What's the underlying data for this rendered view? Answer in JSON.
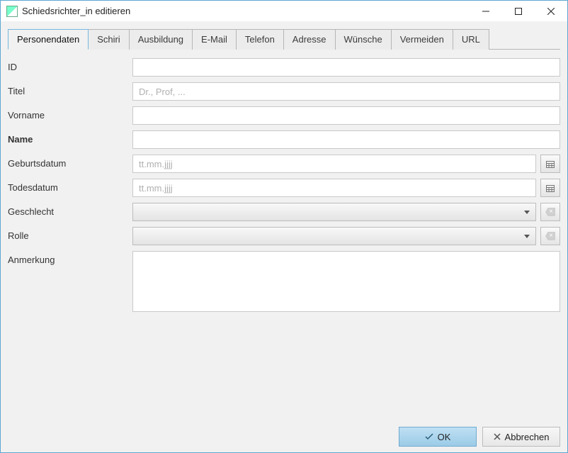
{
  "window": {
    "title": "Schiedsrichter_in editieren"
  },
  "tabs": [
    {
      "label": "Personendaten",
      "id": "personendaten",
      "active": true
    },
    {
      "label": "Schiri",
      "id": "schiri"
    },
    {
      "label": "Ausbildung",
      "id": "ausbildung"
    },
    {
      "label": "E-Mail",
      "id": "email"
    },
    {
      "label": "Telefon",
      "id": "telefon"
    },
    {
      "label": "Adresse",
      "id": "adresse"
    },
    {
      "label": "Wünsche",
      "id": "wuensche"
    },
    {
      "label": "Vermeiden",
      "id": "vermeiden"
    },
    {
      "label": "URL",
      "id": "url"
    }
  ],
  "form": {
    "id": {
      "label": "ID",
      "value": ""
    },
    "titel": {
      "label": "Titel",
      "value": "",
      "placeholder": "Dr., Prof, ..."
    },
    "vorname": {
      "label": "Vorname",
      "value": ""
    },
    "name": {
      "label": "Name",
      "value": ""
    },
    "geburtsdatum": {
      "label": "Geburtsdatum",
      "value": "",
      "placeholder": "tt.mm.jjjj"
    },
    "todesdatum": {
      "label": "Todesdatum",
      "value": "",
      "placeholder": "tt.mm.jjjj"
    },
    "geschlecht": {
      "label": "Geschlecht",
      "selected": ""
    },
    "rolle": {
      "label": "Rolle",
      "selected": ""
    },
    "anmerkung": {
      "label": "Anmerkung",
      "value": ""
    }
  },
  "buttons": {
    "ok": "OK",
    "cancel": "Abbrechen"
  }
}
